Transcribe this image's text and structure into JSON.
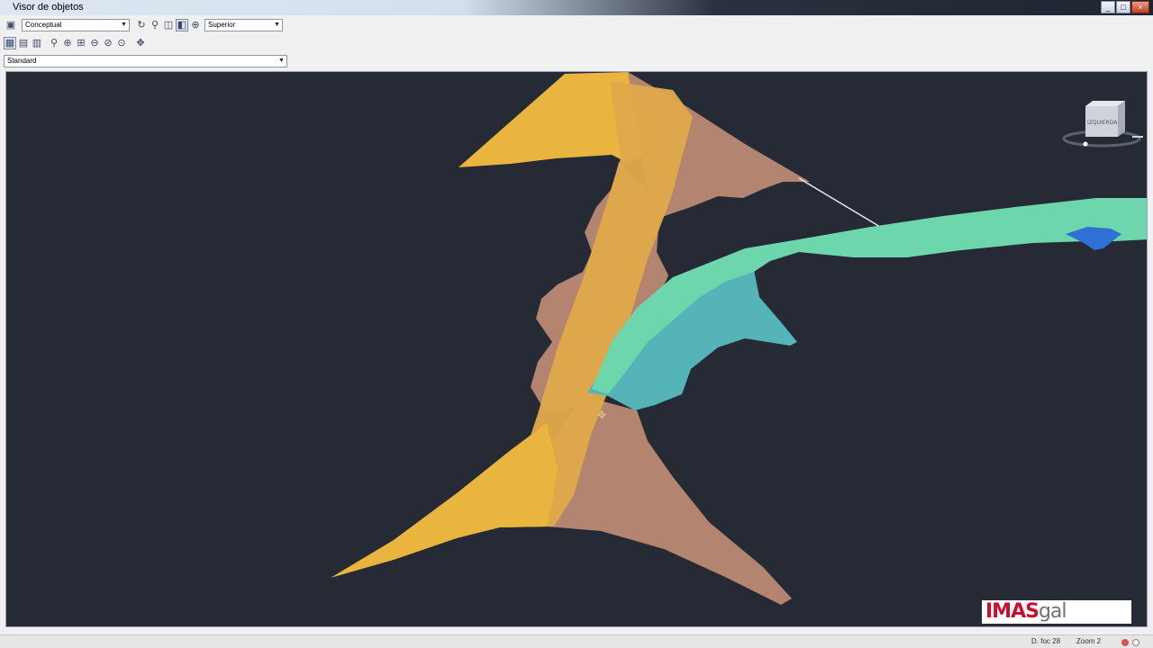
{
  "window": {
    "title": "Visor de objetos"
  },
  "toolbar": {
    "visual_style_value": "Conceptual",
    "view_value": "Superior",
    "icons_row1": [
      "save-icon",
      "orbit-icon",
      "zoom-realtime-icon",
      "zoom-window-icon",
      "visual-style-icon",
      "camera-icon"
    ],
    "icons_row2": [
      "view-toggle-icon",
      "view-mode-icon",
      "view-settings-icon",
      "zoom-icon",
      "zoom-in-icon",
      "zoom-extents-icon",
      "zoom-out-icon",
      "zoom-previous-icon",
      "pan-icon"
    ]
  },
  "style_select": {
    "value": "Standard"
  },
  "viewcube": {
    "face_label": "IZQUIERDA"
  },
  "logo": {
    "part1": "IMAS",
    "part2": "gal"
  },
  "status": {
    "left_text": "D. foc 28",
    "right_text": "Zoom 2"
  },
  "colors": {
    "viewport_bg": "#252a35",
    "surface_yellow": "#eab53e",
    "surface_rose": "#b38470",
    "surface_green": "#6ed6ad",
    "surface_teal": "#55b4b8",
    "surface_blue": "#2f6fd6",
    "logo_red": "#c8102e",
    "logo_gray": "#6f7278"
  }
}
